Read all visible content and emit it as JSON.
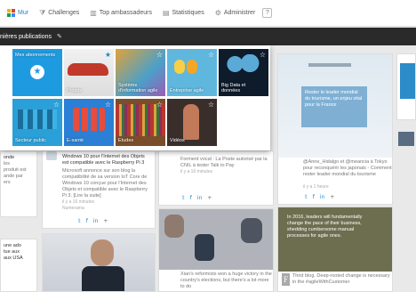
{
  "nav": {
    "items": [
      {
        "label": "Mur",
        "icon": "grid-icon",
        "active": true
      },
      {
        "label": "Challenges",
        "icon": "funnel-icon"
      },
      {
        "label": "Top ambassadeurs",
        "icon": "podium-icon"
      },
      {
        "label": "Statistiques",
        "icon": "chart-icon"
      },
      {
        "label": "Administrer",
        "icon": "gear-icon"
      }
    ],
    "help_label": "?"
  },
  "subbar": {
    "label": "nières publications",
    "edit_icon": "pencil-icon"
  },
  "tiles": [
    {
      "label": "Mes abonnements",
      "star": "on"
    },
    {
      "label": "Projets",
      "star": "on"
    },
    {
      "label": "Système\nd'information agile",
      "star": "off"
    },
    {
      "label": "Entreprise agile",
      "star": "off"
    },
    {
      "label": "Big Data et\ndonnées",
      "star": "off"
    },
    {
      "label": "Secteur public",
      "star": "off"
    },
    {
      "label": "E-santé",
      "star": "off"
    },
    {
      "label": "Etudes",
      "star": "off"
    },
    {
      "label": "Vidéos",
      "star": "off"
    }
  ],
  "cards": {
    "mid_title": "Windows 10 pour l'Internet des Objets est compatible avec le Raspberry Pi 3",
    "mid_body": "Microsoft annonce sur son blog la compatibilité de sa version IoT Core de Windows 10 conçue pour l'Internet des Objets et compatible avec le Raspberry Pi 3. [Lire la suite]",
    "mid_meta": "il y a 16 minutes",
    "mid_src": "Numerama",
    "center_body": "Forment vocal : La Poste autorisé par la CNIL à tester Talk to Pay",
    "center_meta": "il y a 16 minutes",
    "right_title": "Rester le leader mondial du tourisme, un enjeu vital pour la France",
    "right_body": "@Anne_Hidalgo et @meancia à Tokyo pour reconquérir les japonais - Comment rester leader mondial du tourisme",
    "right_meta": "il y a 1 heure",
    "lower_mid_body": "Xian's reformists won a huge victory in the country's elections, but there's a lot more to do",
    "lower_right_quote": "In 2016, leaders will fundamentally change the pace of their business, shedding cumbersome manual processes for agile ones.",
    "lower_right_body": "Third blog. Deep-rooted change is necessary in the #agileWithCustomer",
    "left_text_1": "onde",
    "left_text_2": "les",
    "left_text_3": "produit est",
    "left_text_4": "ande par",
    "left_text_5": "ers",
    "left_text_6": "une ado",
    "left_text_7": "tue aux",
    "left_text_8": "aux USA"
  },
  "colors": {
    "accent": "#1e88c9",
    "subbar": "#2a2a2a",
    "tile_subscriptions": "#1e9be0",
    "tile_health": "#2b7fd4"
  }
}
